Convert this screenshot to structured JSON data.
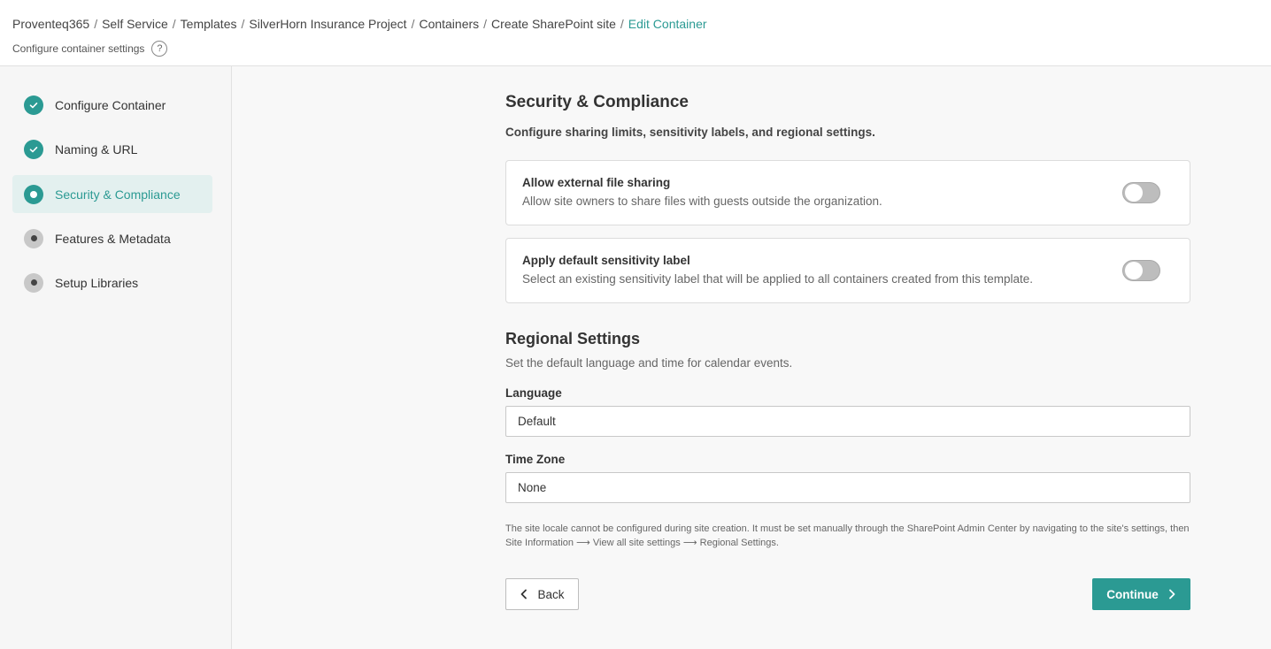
{
  "breadcrumb": {
    "items": [
      "Proventeq365",
      "Self Service",
      "Templates",
      "SilverHorn Insurance Project",
      "Containers",
      "Create SharePoint site"
    ],
    "current": "Edit Container"
  },
  "header": {
    "subtitle": "Configure container settings",
    "help_glyph": "?"
  },
  "steps": [
    {
      "label": "Configure Container",
      "state": "done"
    },
    {
      "label": "Naming & URL",
      "state": "done"
    },
    {
      "label": "Security & Compliance",
      "state": "current"
    },
    {
      "label": "Features & Metadata",
      "state": "pending"
    },
    {
      "label": "Setup Libraries",
      "state": "pending"
    }
  ],
  "security": {
    "title": "Security & Compliance",
    "description": "Configure sharing limits, sensitivity labels, and regional settings.",
    "external_sharing": {
      "title": "Allow external file sharing",
      "description": "Allow site owners to share files with guests outside the organization.",
      "enabled": false
    },
    "sensitivity_label": {
      "title": "Apply default sensitivity label",
      "description": "Select an existing sensitivity label that will be applied to all containers created from this template.",
      "enabled": false
    }
  },
  "regional": {
    "title": "Regional Settings",
    "description": "Set the default language and time for calendar events.",
    "language_label": "Language",
    "language_value": "Default",
    "timezone_label": "Time Zone",
    "timezone_value": "None",
    "note": "The site locale cannot be configured during site creation. It must be set manually through the SharePoint Admin Center by navigating to the site's settings, then Site Information ⟶ View all site settings ⟶ Regional Settings."
  },
  "actions": {
    "back_label": "Back",
    "continue_label": "Continue"
  },
  "colors": {
    "accent": "#2b9a93",
    "active_bg": "#e3f0ef"
  },
  "icons": {
    "done": "check-icon",
    "back": "chevron-left-icon",
    "continue": "chevron-right-icon"
  }
}
